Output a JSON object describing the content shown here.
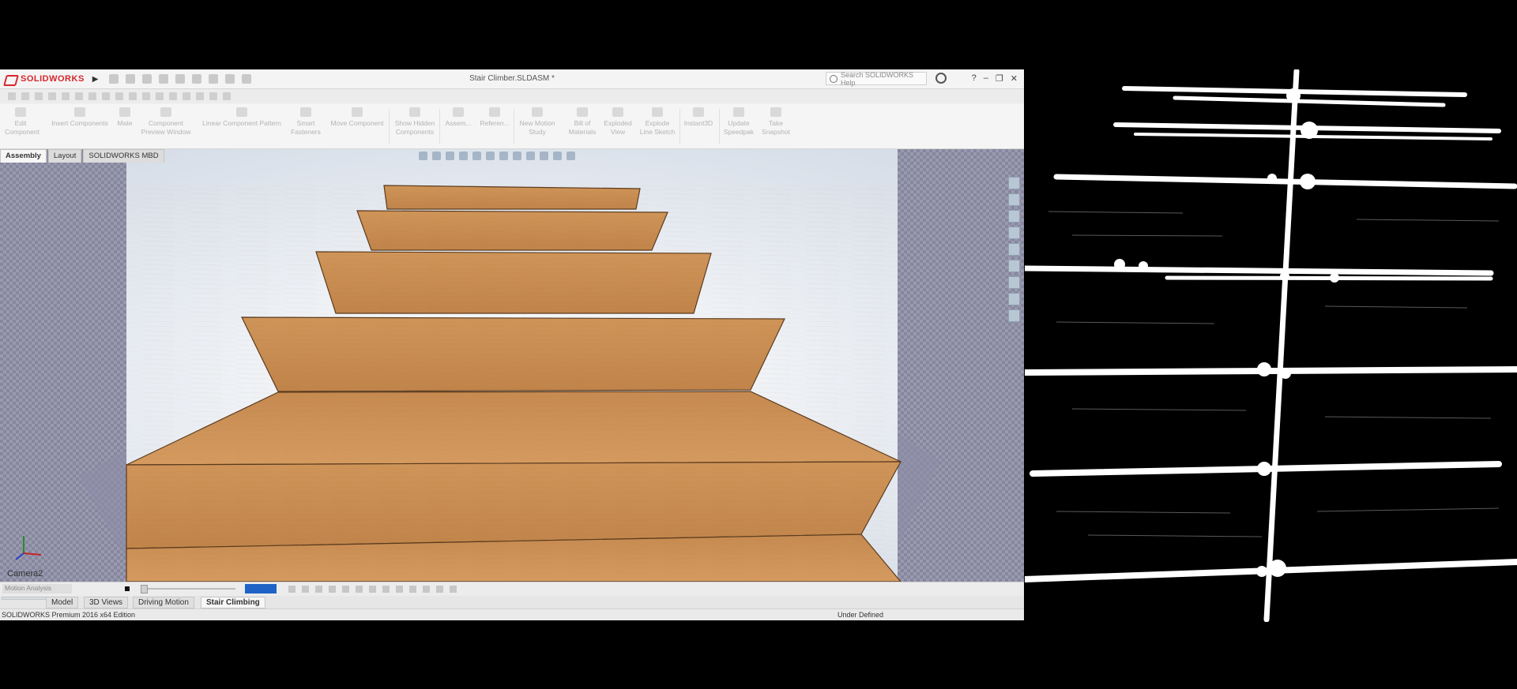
{
  "app": {
    "logo_text": "SOLIDWORKS",
    "document_title": "Stair Climber.SLDASM *",
    "search_placeholder": "Search SOLIDWORKS Help"
  },
  "command_manager": [
    {
      "label1": "Edit",
      "label2": "Component"
    },
    {
      "label1": "Insert Components",
      "label2": ""
    },
    {
      "label1": "Mate",
      "label2": ""
    },
    {
      "label1": "Component",
      "label2": "Preview Window"
    },
    {
      "label1": "Linear Component Pattern",
      "label2": ""
    },
    {
      "label1": "Smart",
      "label2": "Fasteners"
    },
    {
      "label1": "Move Component",
      "label2": ""
    },
    {
      "label1": "Show Hidden",
      "label2": "Components"
    },
    {
      "label1": "Assem...",
      "label2": ""
    },
    {
      "label1": "Referen...",
      "label2": ""
    },
    {
      "label1": "New Motion",
      "label2": "Study"
    },
    {
      "label1": "Bill of",
      "label2": "Materials"
    },
    {
      "label1": "Exploded",
      "label2": "View"
    },
    {
      "label1": "Explode",
      "label2": "Line Sketch"
    },
    {
      "label1": "Instant3D",
      "label2": ""
    },
    {
      "label1": "Update",
      "label2": "Speedpak"
    },
    {
      "label1": "Take",
      "label2": "Snapshot"
    }
  ],
  "tabs": [
    "Assembly",
    "Layout",
    "SOLIDWORKS MBD"
  ],
  "viewport": {
    "camera_label": "Camera2"
  },
  "motion_bar": {
    "study_type": "Motion Analysis"
  },
  "bottom_tabs": [
    "Model",
    "3D Views",
    "Driving Motion",
    "Stair Climbing"
  ],
  "status": {
    "edition": "SOLIDWORKS Premium 2016 x64 Edition",
    "state": "Under Defined"
  },
  "colors": {
    "solidworks_red": "#d8262b",
    "wood": "#c98a4f",
    "scene_side": "#8f8fa8",
    "speed_box": "#1f63c6"
  }
}
